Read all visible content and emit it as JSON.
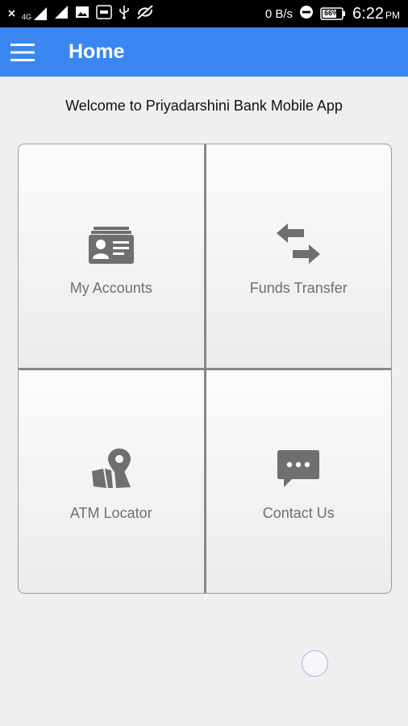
{
  "status_bar": {
    "network_type": "4G",
    "data_speed": "0 B/s",
    "battery_percent": "66%",
    "time": "6:22",
    "ampm": "PM",
    "icons": [
      "close-icon",
      "signal-icon",
      "signal-icon",
      "image-icon",
      "true-app-icon",
      "usb-icon",
      "no-sync-icon",
      "dnd-icon",
      "battery-icon"
    ]
  },
  "app_bar": {
    "title": "Home",
    "menu_icon": "hamburger-menu-icon"
  },
  "welcome_text": "Welcome to Priyadarshini Bank Mobile App",
  "tiles": [
    {
      "label": "My Accounts",
      "icon": "id-card-icon"
    },
    {
      "label": "Funds Transfer",
      "icon": "swap-arrows-icon"
    },
    {
      "label": "ATM Locator",
      "icon": "map-pin-icon"
    },
    {
      "label": "Contact Us",
      "icon": "chat-bubble-icon"
    }
  ],
  "colors": {
    "app_bar": "#3a86f0",
    "background": "#efefef",
    "icon": "#6f6f6f"
  }
}
